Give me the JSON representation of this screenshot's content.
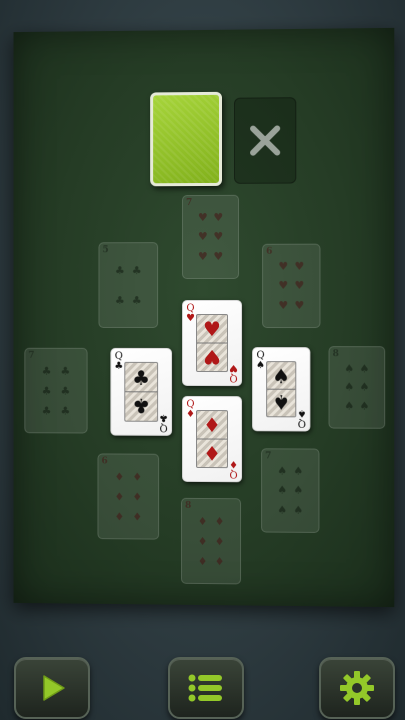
{
  "colors": {
    "accent": "#93c829",
    "felt": "#2a432a",
    "background": "#2f3d42"
  },
  "toolbar": {
    "play_icon": "play-icon",
    "menu_icon": "menu-list-icon",
    "settings_icon": "gear-icon"
  },
  "discard_icon": "close-icon",
  "cards": {
    "queen_hearts": {
      "rank": "Q",
      "suit": "♥"
    },
    "queen_clubs": {
      "rank": "Q",
      "suit": "♣"
    },
    "queen_spades": {
      "rank": "Q",
      "suit": "♠"
    },
    "queen_diamonds": {
      "rank": "Q",
      "suit": "♦"
    },
    "ghost_top": {
      "rank": "7",
      "suit": "♥"
    },
    "ghost_upper_left": {
      "rank": "5",
      "suit": "♣"
    },
    "ghost_upper_right": {
      "rank": "6",
      "suit": "♥"
    },
    "ghost_left": {
      "rank": "7",
      "suit": "♣"
    },
    "ghost_right": {
      "rank": "8",
      "suit": "♠"
    },
    "ghost_lower_left": {
      "rank": "6",
      "suit": "♦"
    },
    "ghost_lower_right": {
      "rank": "7",
      "suit": "♠"
    },
    "ghost_bottom": {
      "rank": "8",
      "suit": "♦"
    }
  }
}
